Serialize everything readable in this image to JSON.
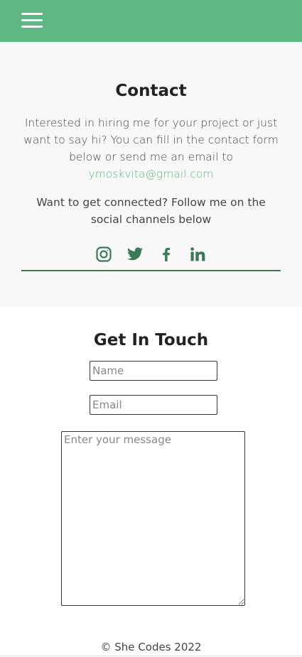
{
  "nav": {
    "menu_icon": "hamburger-menu-icon"
  },
  "contact": {
    "title": "Contact",
    "intro_text": "Interested in hiring me for your project or just want to say hi? You can fill in the contact form below or send me an email to",
    "email_link": "ymoskvita@gmail.com",
    "social_text": "Want to get connected? Follow me on the social channels below",
    "socials": [
      {
        "icon": "instagram-icon"
      },
      {
        "icon": "twitter-icon"
      },
      {
        "icon": "facebook-icon"
      },
      {
        "icon": "linkedin-icon"
      }
    ]
  },
  "form": {
    "title": "Get In Touch",
    "name_placeholder": "Name",
    "email_placeholder": "Email",
    "message_placeholder": "Enter your message"
  },
  "footer": {
    "text": "© She Codes 2022"
  },
  "colors": {
    "accent": "#5fb784",
    "icon": "#3c7a57",
    "section_bg": "#f8f8f8"
  }
}
